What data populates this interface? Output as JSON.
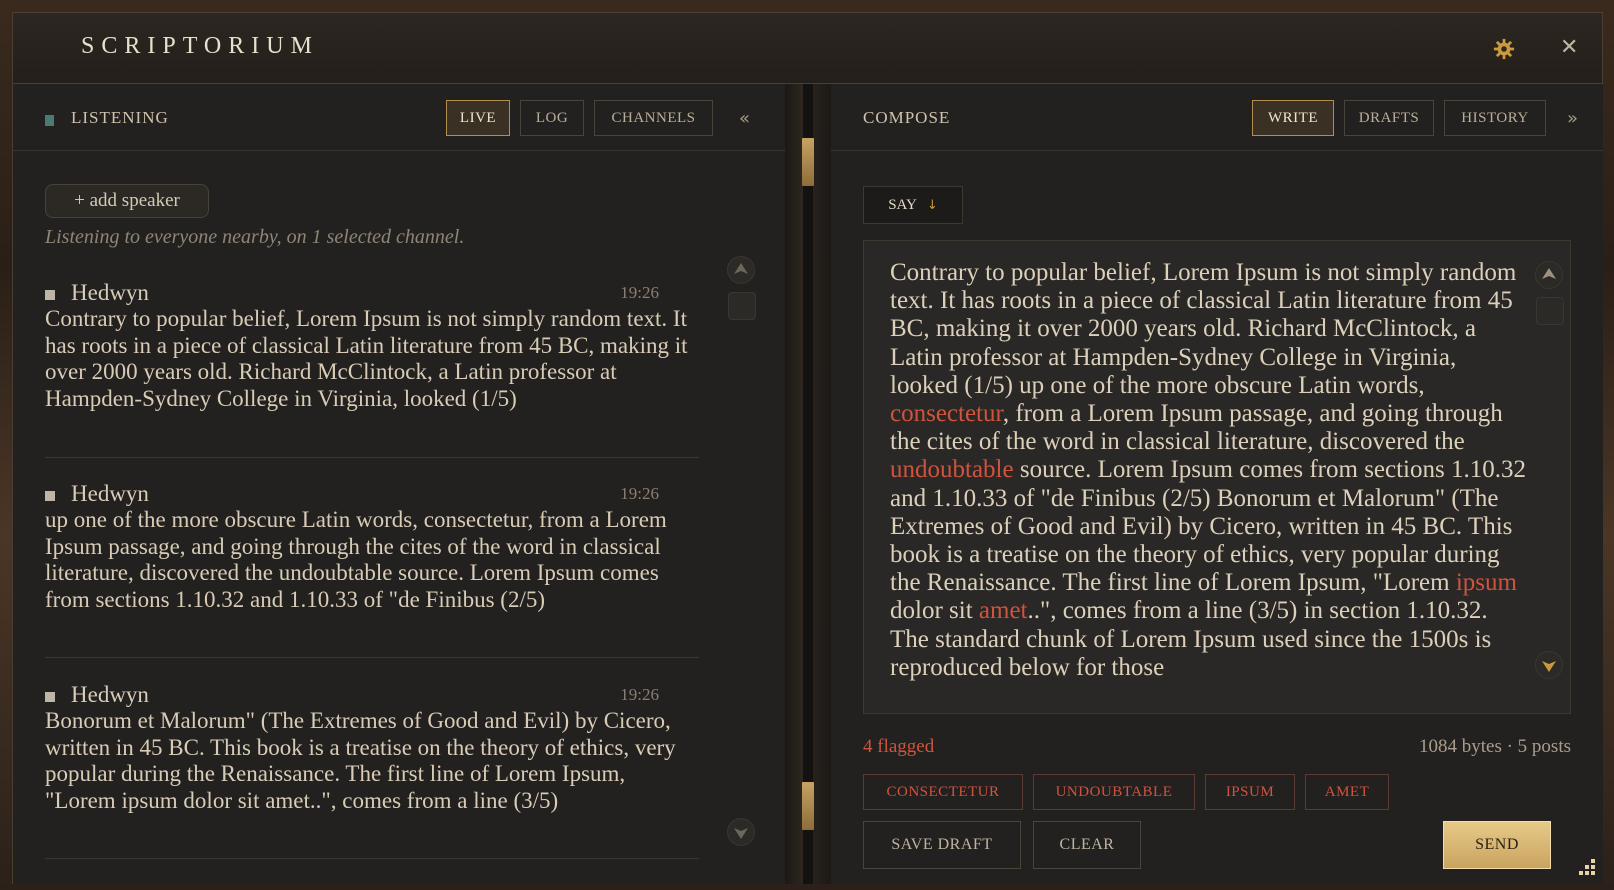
{
  "app": {
    "title": "SCRIPTORIUM"
  },
  "listen": {
    "header": "LISTENING",
    "tabs": [
      {
        "label": "LIVE",
        "active": true
      },
      {
        "label": "LOG"
      },
      {
        "label": "CHANNELS"
      }
    ],
    "collapse": "«",
    "add_speaker": "+ add speaker",
    "note": "Listening to everyone nearby, on 1 selected channel.",
    "messages": [
      {
        "speaker": "Hedwyn",
        "time": "19:26",
        "text": "Contrary to popular belief, Lorem Ipsum is not simply random text. It has roots in a piece of classical Latin literature from 45 BC, making it over 2000 years old. Richard McClintock, a Latin professor at Hampden-Sydney College in Virginia, looked (1/5)"
      },
      {
        "speaker": "Hedwyn",
        "time": "19:26",
        "text": "up one of the more obscure Latin words, consectetur, from a Lorem Ipsum passage, and going through the cites of the word in classical literature, discovered the undoubtable source. Lorem Ipsum comes from sections 1.10.32 and 1.10.33 of \"de Finibus (2/5)"
      },
      {
        "speaker": "Hedwyn",
        "time": "19:26",
        "text": "Bonorum et Malorum\" (The Extremes of Good and Evil) by Cicero, written in 45 BC. This book is a treatise on the theory of ethics, very popular during the Renaissance. The first line of Lorem Ipsum, \"Lorem ipsum dolor sit amet..\", comes from a line (3/5)"
      }
    ]
  },
  "compose": {
    "header": "COMPOSE",
    "tabs": [
      {
        "label": "WRITE",
        "active": true
      },
      {
        "label": "DRAFTS"
      },
      {
        "label": "HISTORY"
      }
    ],
    "expand": "»",
    "mode": "SAY",
    "mode_arrow": "↓",
    "text": {
      "p1": "Contrary to popular belief, Lorem Ipsum is not simply random text. It has roots in a piece of classical Latin literature from 45 BC, making it over 2000 years old. Richard McClintock, a Latin professor at Hampden-Sydney College in Virginia, looked (1/5) up one of the more obscure Latin words, ",
      "f1": "consectetur",
      "p2": ", from a Lorem Ipsum passage, and going through the cites of the word in classical literature, discovered the ",
      "f2": "undoubtable",
      "p3": " source. Lorem Ipsum comes from sections 1.10.32 and 1.10.33 of \"de Finibus (2/5) Bonorum et Malorum\" (The Extremes of Good and Evil) by Cicero, written in 45 BC. This book is a treatise on the theory of ethics, very popular during the Renaissance. The first line of Lorem Ipsum, \"Lorem ",
      "f3": "ipsum",
      "p4": " dolor sit ",
      "f4": "amet",
      "p5": "..\", comes from a line (3/5) in section 1.10.32. The standard chunk of Lorem Ipsum used since the 1500s is reproduced below for those"
    },
    "flagged": "4 flagged",
    "bytes": "1084 bytes · 5 posts",
    "flags": [
      "CONSECTETUR",
      "UNDOUBTABLE",
      "IPSUM",
      "AMET"
    ],
    "actions": {
      "save_draft": "SAVE DRAFT",
      "clear": "CLEAR",
      "send": "SEND"
    }
  },
  "colors": {
    "accent_gold": "#c9a460",
    "flag_red": "#d0533e",
    "live_dot": "#4a7a74"
  }
}
